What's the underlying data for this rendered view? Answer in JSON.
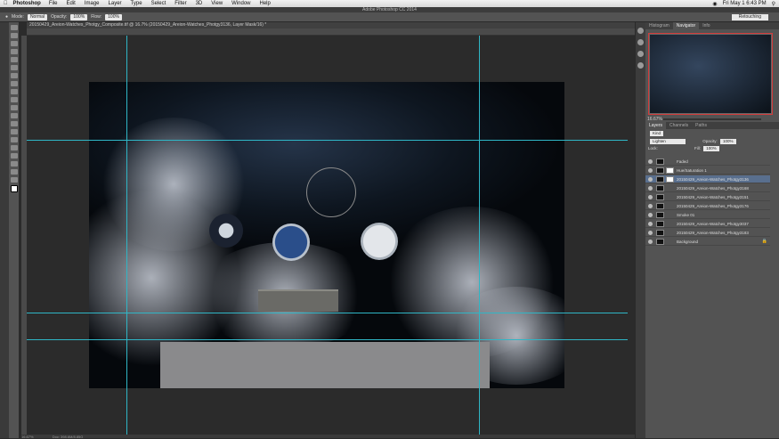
{
  "menubar": {
    "apple": "",
    "app": "Photoshop",
    "items": [
      "File",
      "Edit",
      "Image",
      "Layer",
      "Type",
      "Select",
      "Filter",
      "3D",
      "View",
      "Window",
      "Help"
    ],
    "clock": "Fri May 1  6:43 PM"
  },
  "window": {
    "title": "Adobe Photoshop CC 2014"
  },
  "options": {
    "mode_label": "Mode:",
    "mode_value": "Normal",
    "opacity_label": "Opacity:",
    "opacity_value": "100%",
    "flow_label": "Flow:",
    "flow_value": "100%",
    "workspace": "Retouching"
  },
  "document": {
    "tab": "20150429_Areion-Watches_Photgy_Composite.tif @ 16.7% (20150429_Areion-Watches_Photgy3136, Layer Mask/16) *"
  },
  "panel": {
    "tabs": [
      "Histogram",
      "Navigator",
      "Info"
    ],
    "zoom": "16.67%",
    "layer_tabs": [
      "Layers",
      "Channels",
      "Paths"
    ],
    "kind": "Kind",
    "blend": "Lighten",
    "opacity_label": "Opacity:",
    "opacity_value": "100%",
    "lock_label": "Lock:",
    "fill_label": "Fill:",
    "fill_value": "100%"
  },
  "layers": [
    {
      "name": "Faded",
      "selected": false
    },
    {
      "name": "Hue/Saturation 1",
      "selected": false
    },
    {
      "name": "20150429_Areion-Watches_Photgy3136",
      "selected": true
    },
    {
      "name": "20150429_Areion-Watches_Photgy3168",
      "selected": false
    },
    {
      "name": "20150429_Areion-Watches_Photgy3151",
      "selected": false
    },
    {
      "name": "20150429_Areion-Watches_Photgy3176",
      "selected": false
    },
    {
      "name": "Smoke 01",
      "selected": false
    },
    {
      "name": "20150429_Areion-Watches_Photgy3037",
      "selected": false
    },
    {
      "name": "20150429_Areion-Watches_Photgy3183",
      "selected": false
    },
    {
      "name": "Background",
      "selected": false
    }
  ],
  "status": {
    "zoom": "16.67%",
    "doc": "Doc: 398.6M/8.85G"
  }
}
